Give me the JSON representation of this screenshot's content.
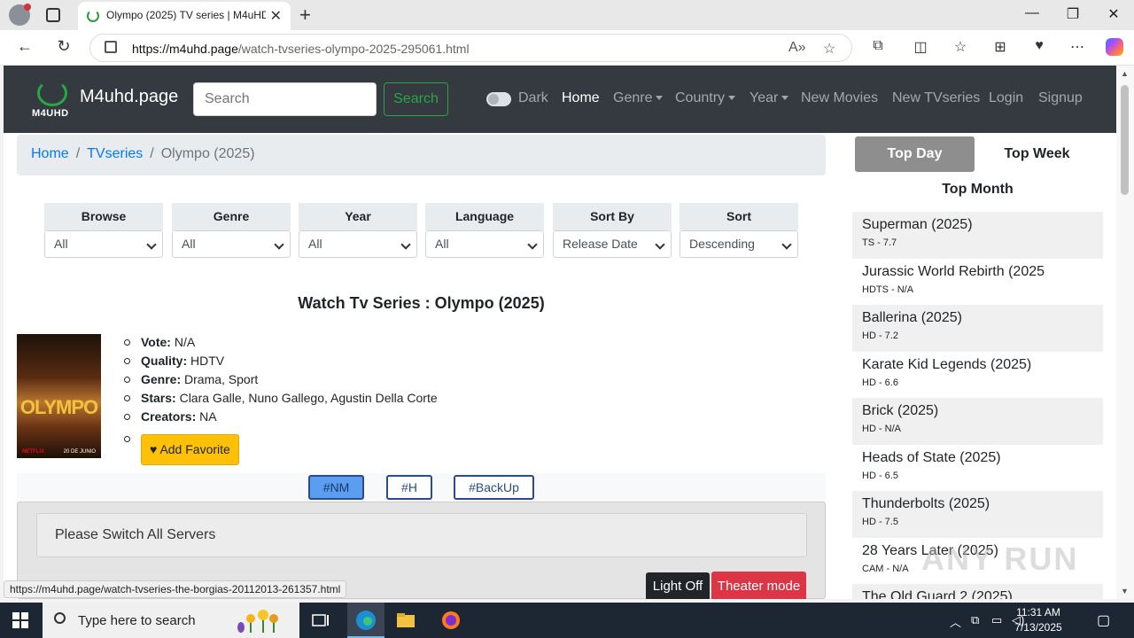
{
  "browser": {
    "tab_title": "Olympo (2025) TV series | M4uHD",
    "url_domain": "https://m4uhd.page",
    "url_path": "/watch-tvseries-olympo-2025-295061.html",
    "status_url": "https://m4uhd.page/watch-tvseries-the-borgias-20112013-261357.html"
  },
  "site": {
    "logo_text": "M4UHD",
    "brand": "M4uhd.page",
    "search_placeholder": "Search",
    "search_button": "Search",
    "dark_label": "Dark",
    "nav": {
      "home": "Home",
      "genre": "Genre",
      "country": "Country",
      "year": "Year",
      "new_movies": "New Movies",
      "new_tvseries": "New TVseries",
      "login": "Login",
      "signup": "Signup"
    }
  },
  "breadcrumb": {
    "home": "Home",
    "tvseries": "TVseries",
    "current": "Olympo (2025)",
    "separator": "/"
  },
  "filters": [
    {
      "label": "Browse",
      "value": "All"
    },
    {
      "label": "Genre",
      "value": "All"
    },
    {
      "label": "Year",
      "value": "All"
    },
    {
      "label": "Language",
      "value": "All"
    },
    {
      "label": "Sort By",
      "value": "Release Date"
    },
    {
      "label": "Sort",
      "value": "Descending"
    }
  ],
  "movie": {
    "watch_title": "Watch Tv Series : Olympo (2025)",
    "poster_title": "OLYMPO",
    "poster_netflix": "NETFLIX",
    "poster_date": "20 DE JUNIO",
    "vote_label": "Vote:",
    "vote": "N/A",
    "quality_label": "Quality:",
    "quality": "HDTV",
    "genre_label": "Genre:",
    "genre": "Drama, Sport",
    "stars_label": "Stars:",
    "stars": "Clara Galle, Nuno Gallego, Agustin Della Corte",
    "creators_label": "Creators:",
    "creators": "NA",
    "fav_button": "Add Favorite"
  },
  "servers": {
    "buttons": [
      "#NM",
      "#H",
      "#BackUp"
    ],
    "notice": "Please Switch All Servers",
    "light_off": "Light Off",
    "theater_mode": "Theater mode"
  },
  "sidebar": {
    "tab_day": "Top Day",
    "tab_week": "Top Week",
    "tab_month": "Top Month",
    "items": [
      {
        "title": "Superman (2025)",
        "sub": "TS - 7.7"
      },
      {
        "title": "Jurassic World Rebirth (2025",
        "sub": "HDTS - N/A"
      },
      {
        "title": "Ballerina (2025)",
        "sub": "HD - 7.2"
      },
      {
        "title": "Karate Kid Legends (2025)",
        "sub": "HD - 6.6"
      },
      {
        "title": "Brick (2025)",
        "sub": "HD - N/A"
      },
      {
        "title": "Heads of State (2025)",
        "sub": "HD - 6.5"
      },
      {
        "title": "Thunderbolts (2025)",
        "sub": "HD - 7.5"
      },
      {
        "title": "28 Years Later (2025)",
        "sub": "CAM - N/A"
      },
      {
        "title": "The Old Guard 2 (2025)",
        "sub": ""
      }
    ]
  },
  "watermark": "ANY RUN",
  "taskbar": {
    "search_placeholder": "Type here to search",
    "time": "11:31 AM",
    "date": "7/13/2025"
  }
}
